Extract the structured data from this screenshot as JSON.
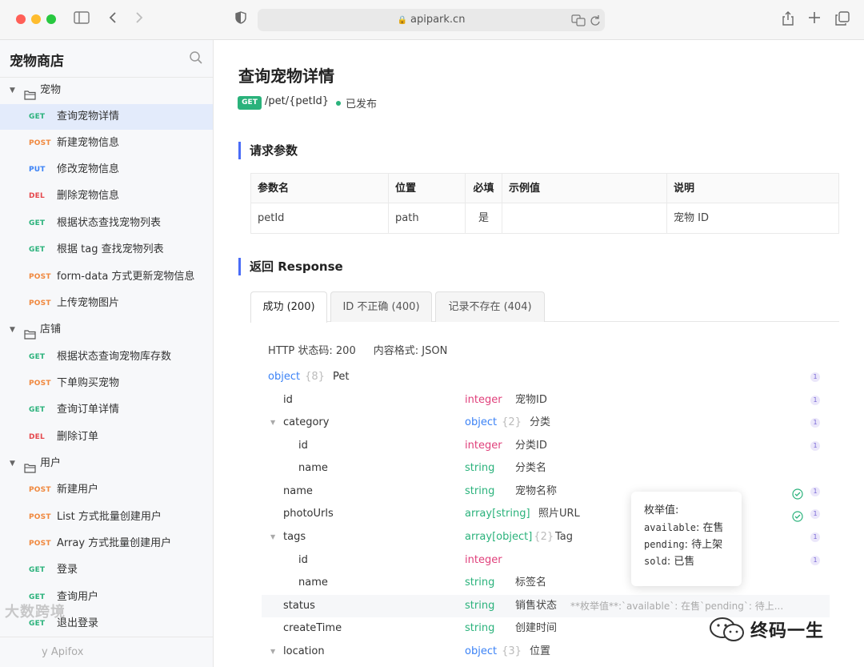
{
  "browser": {
    "url": "apipark.cn"
  },
  "sidebar": {
    "title": "宠物商店",
    "folders": [
      {
        "label": "宠物"
      },
      {
        "label": "店铺"
      },
      {
        "label": "用户"
      }
    ],
    "items": [
      {
        "method": "GET",
        "label": "查询宠物详情"
      },
      {
        "method": "POST",
        "label": "新建宠物信息"
      },
      {
        "method": "PUT",
        "label": "修改宠物信息"
      },
      {
        "method": "DEL",
        "label": "删除宠物信息"
      },
      {
        "method": "GET",
        "label": "根据状态查找宠物列表"
      },
      {
        "method": "GET",
        "label": "根据 tag 查找宠物列表"
      },
      {
        "method": "POST",
        "label": "form-data 方式更新宠物信息"
      },
      {
        "method": "POST",
        "label": "上传宠物图片"
      },
      {
        "method": "GET",
        "label": "根据状态查询宠物库存数"
      },
      {
        "method": "POST",
        "label": "下单购买宠物"
      },
      {
        "method": "GET",
        "label": "查询订单详情"
      },
      {
        "method": "DEL",
        "label": "删除订单"
      },
      {
        "method": "POST",
        "label": "新建用户"
      },
      {
        "method": "POST",
        "label": "List 方式批量创建用户"
      },
      {
        "method": "POST",
        "label": "Array 方式批量创建用户"
      },
      {
        "method": "GET",
        "label": "登录"
      },
      {
        "method": "GET",
        "label": "查询用户"
      },
      {
        "method": "GET",
        "label": "退出登录"
      }
    ],
    "footer": "y Apifox",
    "watermark": "大数跨境"
  },
  "main": {
    "title": "查询宠物详情",
    "method": "GET",
    "path": "/pet/{petId}",
    "status": "已发布",
    "params_heading": "请求参数",
    "params_table": {
      "headers": [
        "参数名",
        "位置",
        "必填",
        "示例值",
        "说明"
      ],
      "rows": [
        [
          "petId",
          "path",
          "是",
          "",
          "宠物 ID"
        ]
      ]
    },
    "response_heading": "返回 Response",
    "tabs": [
      "成功 (200)",
      "ID 不正确 (400)",
      "记录不存在 (404)"
    ],
    "http_status": "HTTP 状态码: 200",
    "content_format": "内容格式: JSON",
    "schema": [
      {
        "name": "object",
        "count": "{8}",
        "type": "",
        "desc": "Pet",
        "badge": "1"
      },
      {
        "name": "id",
        "type": "integer",
        "desc": "宠物ID",
        "badge": "1"
      },
      {
        "name": "category",
        "type": "object",
        "count": "{2}",
        "desc": "分类",
        "badge": "1"
      },
      {
        "name": "id",
        "type": "integer",
        "desc": "分类ID",
        "badge": "1"
      },
      {
        "name": "name",
        "type": "string",
        "desc": "分类名"
      },
      {
        "name": "name",
        "type": "string",
        "desc": "宠物名称",
        "badge": "1"
      },
      {
        "name": "photoUrls",
        "type": "array[string]",
        "desc": "照片URL",
        "badge": "1"
      },
      {
        "name": "tags",
        "type": "array[object]",
        "count": "{2}",
        "desc": "Tag",
        "badge": "1"
      },
      {
        "name": "id",
        "type": "integer",
        "desc": "",
        "badge": "1"
      },
      {
        "name": "name",
        "type": "string",
        "desc": "标签名"
      },
      {
        "name": "status",
        "type": "string",
        "desc": "销售状态",
        "extra": "**枚举值**:`available`: 在售`pending`: 待上..."
      },
      {
        "name": "createTime",
        "type": "string",
        "desc": "创建时间"
      },
      {
        "name": "location",
        "type": "object",
        "count": "{3}",
        "desc": "位置"
      }
    ],
    "tooltip": {
      "title": "枚举值:",
      "lines": [
        {
          "key": "available",
          "value": ": 在售"
        },
        {
          "key": "pending",
          "value": ": 待上架"
        },
        {
          "key": "sold",
          "value": ": 已售"
        }
      ]
    },
    "watermark": "终码一生"
  }
}
